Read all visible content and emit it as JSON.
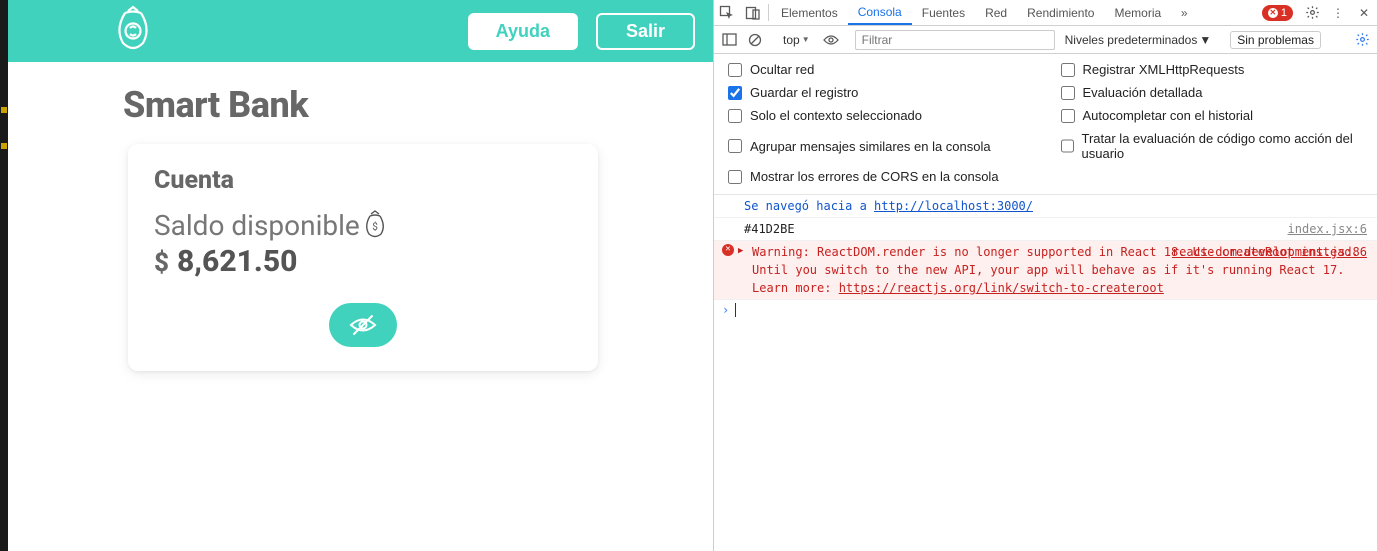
{
  "app": {
    "header": {
      "help_label": "Ayuda",
      "logout_label": "Salir"
    },
    "page_title": "Smart Bank",
    "card": {
      "heading": "Cuenta",
      "balance_label": "Saldo disponible",
      "currency": "$",
      "balance_value": "8,621.50"
    }
  },
  "devtools": {
    "tabs": {
      "elementos": "Elementos",
      "consola": "Consola",
      "fuentes": "Fuentes",
      "red": "Red",
      "rendimiento": "Rendimiento",
      "memoria": "Memoria"
    },
    "error_count": "1",
    "toolbar": {
      "context": "top",
      "filter_placeholder": "Filtrar",
      "levels_label": "Niveles predeterminados",
      "no_problems": "Sin problemas"
    },
    "options": {
      "ocultar_red": "Ocultar red",
      "registrar_xhr": "Registrar XMLHttpRequests",
      "guardar_registro": "Guardar el registro",
      "eval_detallada": "Evaluación detallada",
      "solo_contexto": "Solo el contexto seleccionado",
      "autocompletar": "Autocompletar con el historial",
      "agrupar": "Agrupar mensajes similares en la consola",
      "tratar_eval": "Tratar la evaluación de código como acción del usuario",
      "mostrar_cors": "Mostrar los errores de CORS en la consola"
    },
    "logs": {
      "nav_prefix": "Se navegó hacia a ",
      "nav_url": "http://localhost:3000/",
      "hex_value": "#41D2BE",
      "hex_source": "index.jsx:6",
      "warn_body_1": "Warning: ReactDOM.render is no longer supported in React 18. Use createRoot instead. Until you switch to the new API, your app will behave as if it's running React 17. Learn more: ",
      "warn_link": "https://reactjs.org/link/switch-to-createroot",
      "warn_source": "react-dom.development.js:86"
    }
  }
}
